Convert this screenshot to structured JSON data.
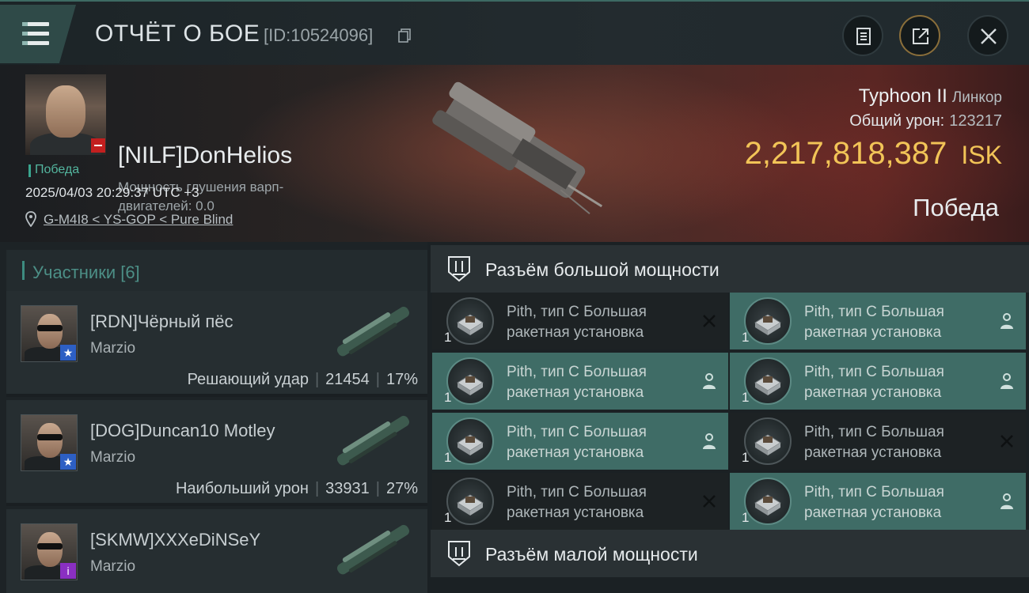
{
  "header": {
    "title": "ОТЧЁТ О БОЕ",
    "report_id": "[ID:10524096]"
  },
  "victim": {
    "name": "[NILF]DonHelios",
    "warp_label": "Мощность глушения варп-двигателей: 0.0",
    "status": "Победа",
    "datetime": "2025/04/03 20:29:37 UTC +3",
    "location": "G-M4I8 < YS-GOP < Pure Blind",
    "ship": "Typhoon II",
    "ship_class": "Линкор",
    "damage_label": "Общий урон:",
    "damage_value": "123217",
    "isk_value": "2,217,818,387",
    "isk_unit": "ISK",
    "result": "Победа"
  },
  "participants": {
    "title": "Участники [6]",
    "rows": [
      {
        "name": "[RDN]Чёрный пёс",
        "corp": "Marzio",
        "stat_label": "Решающий удар",
        "damage": "21454",
        "percent": "17%",
        "badge": "★",
        "badge_color": "#2d5fc4"
      },
      {
        "name": "[DOG]Duncan10 Motley",
        "corp": "Marzio",
        "stat_label": "Наибольший урон",
        "damage": "33931",
        "percent": "27%",
        "badge": "★",
        "badge_color": "#2d5fc4"
      },
      {
        "name": "[SKMW]XXXeDiNSeY",
        "corp": "Marzio",
        "stat_label": "",
        "damage": "",
        "percent": "",
        "badge": "i",
        "badge_color": "#8a2fc2"
      }
    ]
  },
  "high_slots": {
    "title": "Разъём большой мощности",
    "modules": [
      {
        "line1": "Pith, тип C Большая",
        "line2": "ракетная установка",
        "qty": "1",
        "state": "destroyed"
      },
      {
        "line1": "Pith, тип C Большая",
        "line2": "ракетная установка",
        "qty": "1",
        "state": "dropped"
      },
      {
        "line1": "Pith, тип C Большая",
        "line2": "ракетная установка",
        "qty": "1",
        "state": "dropped"
      },
      {
        "line1": "Pith, тип C Большая",
        "line2": "ракетная установка",
        "qty": "1",
        "state": "dropped"
      },
      {
        "line1": "Pith, тип C Большая",
        "line2": "ракетная установка",
        "qty": "1",
        "state": "dropped"
      },
      {
        "line1": "Pith, тип C Большая",
        "line2": "ракетная установка",
        "qty": "1",
        "state": "destroyed"
      },
      {
        "line1": "Pith, тип C Большая",
        "line2": "ракетная установка",
        "qty": "1",
        "state": "destroyed"
      },
      {
        "line1": "Pith, тип C Большая",
        "line2": "ракетная установка",
        "qty": "1",
        "state": "dropped"
      }
    ]
  },
  "low_slots": {
    "title": "Разъём малой мощности"
  },
  "colors": {
    "accent": "#3f6c66",
    "isk": "#f2c457",
    "status_green": "#54b69f"
  }
}
